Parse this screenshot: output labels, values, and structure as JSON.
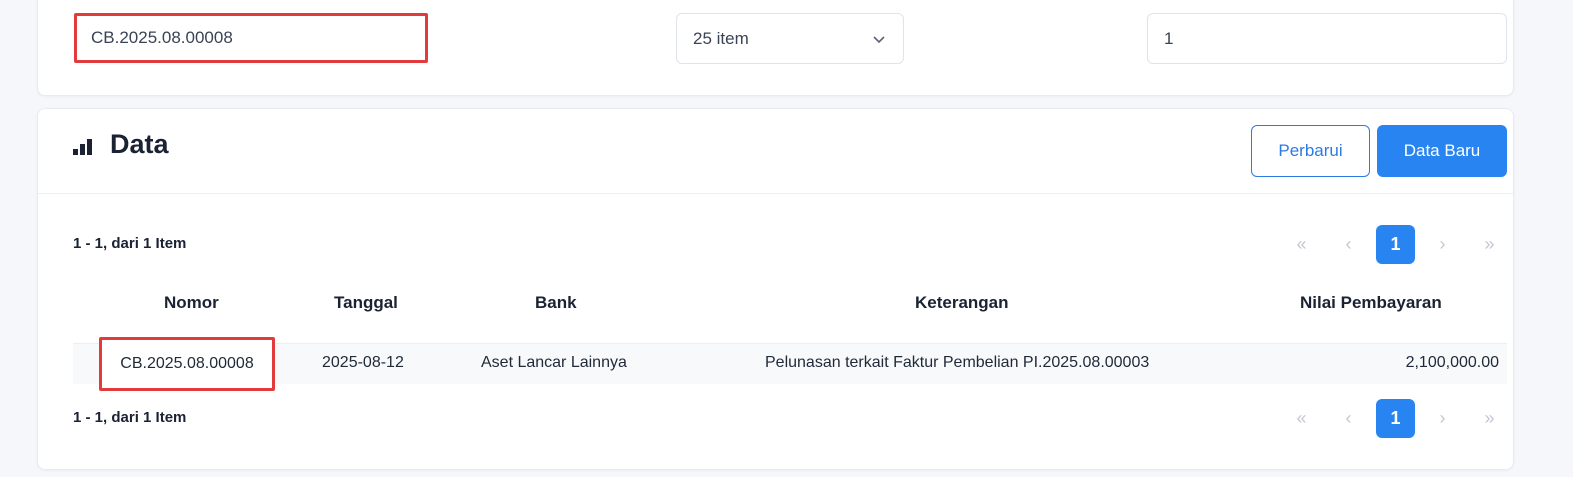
{
  "filters": {
    "search_value": "CB.2025.08.00008",
    "per_page": "25 item",
    "page_value": "1"
  },
  "section": {
    "title": "Data",
    "refresh_label": "Perbarui",
    "new_label": "Data Baru"
  },
  "summary": "1 - 1, dari 1 Item",
  "pagination": {
    "first": "«",
    "prev": "‹",
    "current": "1",
    "next": "›",
    "last": "»"
  },
  "table": {
    "columns": [
      "Nomor",
      "Tanggal",
      "Bank",
      "Keterangan",
      "Nilai Pembayaran"
    ],
    "rows": [
      [
        "CB.2025.08.00008",
        "2025-08-12",
        "Aset Lancar Lainnya",
        "Pelunasan terkait Faktur Pembelian PI.2025.08.00003",
        "2,100,000.00"
      ]
    ]
  },
  "colors": {
    "accent": "#2784f0",
    "highlight": "#e23b3b"
  },
  "icons": {
    "section": "bar-chart-icon",
    "select": "chevron-down-icon"
  }
}
